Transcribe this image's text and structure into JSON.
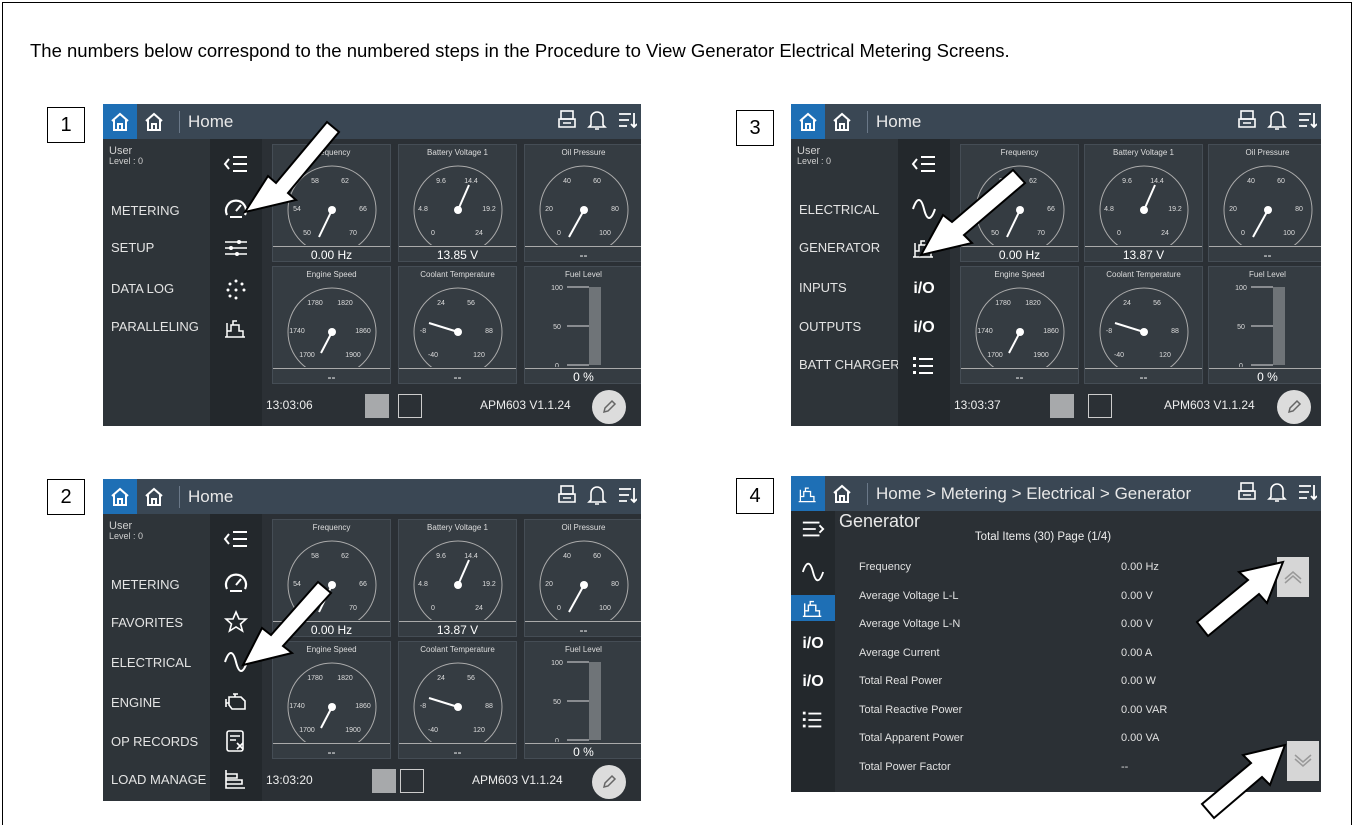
{
  "intro": "The numbers below correspond to the numbered steps in the Procedure to View Generator Electrical Metering Screens.",
  "steps": [
    "1",
    "2",
    "3",
    "4"
  ],
  "home": "Home",
  "user": "User",
  "level": "Level : 0",
  "version": "APM603 V1.1.24",
  "s1": {
    "menu": [
      "METERING",
      "SETUP",
      "DATA LOG",
      "PARALLELING"
    ],
    "time": "13:03:06",
    "values": [
      "0.00 Hz",
      "13.85 V",
      "--",
      "--",
      "--",
      "0 %"
    ]
  },
  "s2": {
    "menu": [
      "METERING",
      "FAVORITES",
      "ELECTRICAL",
      "ENGINE",
      "OP RECORDS",
      "LOAD MANAGE"
    ],
    "time": "13:03:20",
    "values": [
      "0.00 Hz",
      "13.87 V",
      "--",
      "--",
      "--",
      "0 %"
    ]
  },
  "s3": {
    "menu": [
      "ELECTRICAL",
      "GENERATOR",
      "INPUTS",
      "OUTPUTS",
      "BATT CHARGER"
    ],
    "time": "13:03:37",
    "values": [
      "0.00 Hz",
      "13.87 V",
      "--",
      "--",
      "--",
      "0 %"
    ]
  },
  "gauges": [
    {
      "title": "Frequency",
      "ticks": [
        "58",
        "62",
        "54",
        "66",
        "50",
        "70"
      ]
    },
    {
      "title": "Battery Voltage 1",
      "ticks": [
        "9.6",
        "14.4",
        "4.8",
        "19.2",
        "0",
        "24"
      ]
    },
    {
      "title": "Oil Pressure",
      "ticks": [
        "40",
        "60",
        "20",
        "80",
        "0",
        "100"
      ]
    },
    {
      "title": "Engine Speed",
      "ticks": [
        "1780",
        "1820",
        "1740",
        "1860",
        "1700",
        "1900"
      ]
    },
    {
      "title": "Coolant Temperature",
      "ticks": [
        "24",
        "56",
        "-8",
        "88",
        "-40",
        "120"
      ]
    },
    {
      "title": "Fuel Level",
      "ticks": [
        "100",
        "50",
        "0"
      ]
    }
  ],
  "s4": {
    "breadcrumb": "Home > Metering > Electrical > Generator",
    "title": "Generator",
    "summary": "Total Items (30) Page (1/4)",
    "rows": [
      {
        "label": "Frequency",
        "value": "0.00 Hz"
      },
      {
        "label": "Average Voltage L-L",
        "value": "0.00 V"
      },
      {
        "label": "Average Voltage L-N",
        "value": "0.00 V"
      },
      {
        "label": "Average Current",
        "value": "0.00 A"
      },
      {
        "label": "Total Real Power",
        "value": "0.00 W"
      },
      {
        "label": "Total Reactive Power",
        "value": "0.00 VAR"
      },
      {
        "label": "Total Apparent Power",
        "value": "0.00 VA"
      },
      {
        "label": "Total Power Factor",
        "value": "--"
      }
    ]
  },
  "icons": {
    "io_label": "i/O"
  }
}
